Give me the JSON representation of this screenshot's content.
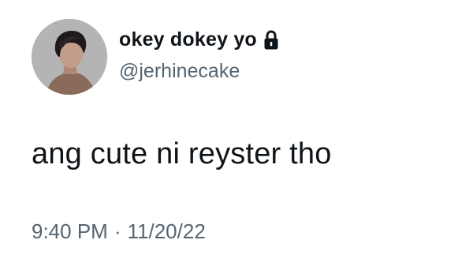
{
  "tweet": {
    "author": {
      "display_name": "okey dokey yo",
      "handle": "@jerhinecake",
      "avatar_icon": "profile-photo",
      "protected_icon": "lock-icon"
    },
    "text": "ang cute ni reyster tho",
    "time": "9:40 PM",
    "separator": "·",
    "date": "11/20/22"
  },
  "colors": {
    "primary_text": "#0f1419",
    "secondary_text": "#536471",
    "background": "#ffffff"
  }
}
